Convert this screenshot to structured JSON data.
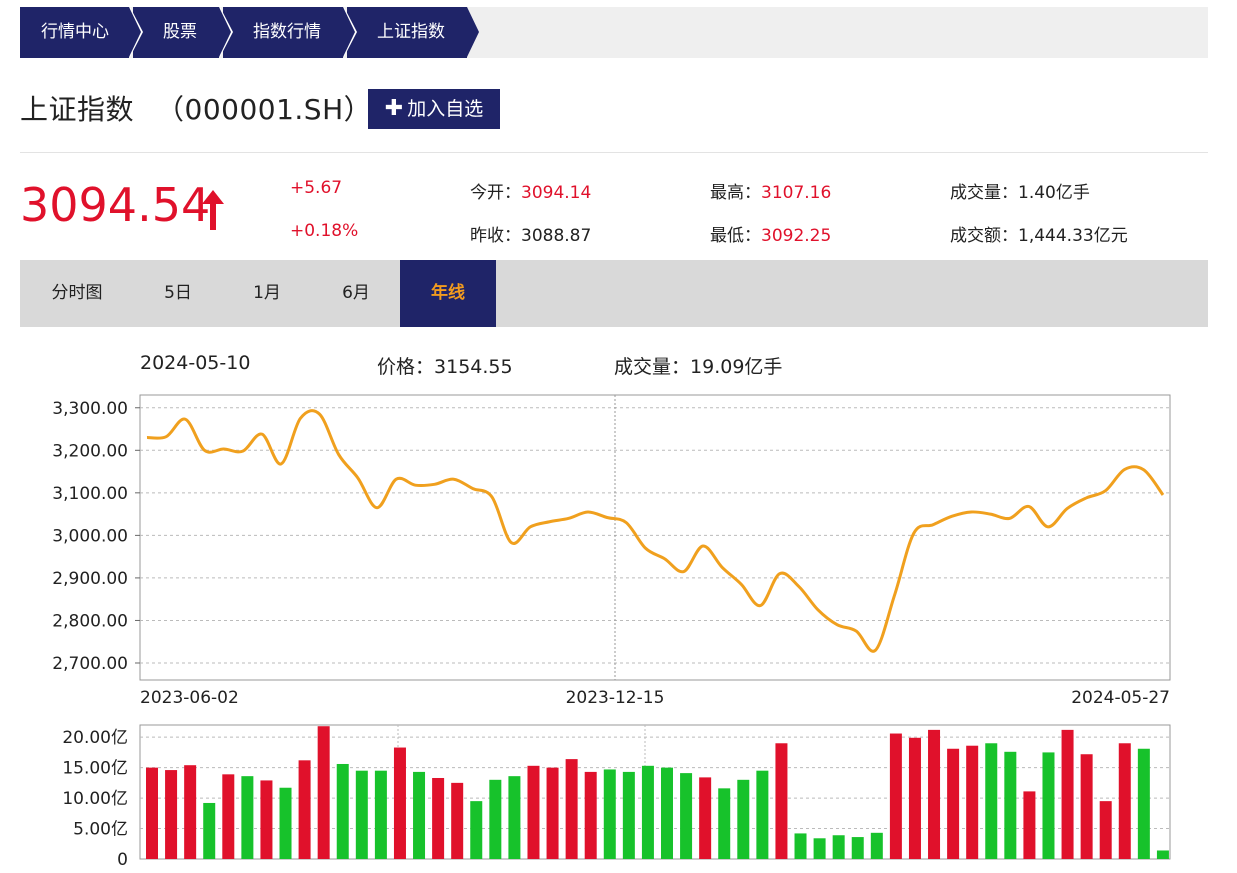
{
  "breadcrumb": [
    "行情中心",
    "股票",
    "指数行情",
    "上证指数"
  ],
  "title": {
    "name": "上证指数",
    "code": "（000001.SH）"
  },
  "add_button": {
    "icon": "plus-icon",
    "label": "加入自选"
  },
  "quote": {
    "price": "3094.54",
    "direction_icon": "arrow-up-icon",
    "change": "+5.67",
    "change_pct": "+0.18%",
    "open_label": "今开：",
    "open": "3094.14",
    "prev_close_label": "昨收：",
    "prev_close": "3088.87",
    "high_label": "最高：",
    "high": "3107.16",
    "low_label": "最低：",
    "low": "3092.25",
    "volume_label": "成交量：",
    "volume": "1.40亿手",
    "amount_label": "成交额：",
    "amount": "1,444.33亿元"
  },
  "tabs": [
    "分时图",
    "5日",
    "1月",
    "6月",
    "年线"
  ],
  "active_tab": 4,
  "hover_info": {
    "date": "2024-05-10",
    "price_label": "价格：",
    "price": "3154.55",
    "volume_label": "成交量：",
    "volume": "19.09亿手"
  },
  "colors": {
    "navy": "#1f2468",
    "red": "#e0112b",
    "green": "#17c22b",
    "line": "#f0a01e",
    "active_tab_text": "#f39c1e"
  },
  "chart_data": [
    {
      "type": "line",
      "title": "",
      "x_ticks": [
        "2023-06-02",
        "2023-12-15",
        "2024-05-27"
      ],
      "y_ticks": [
        "3,300.00",
        "3,200.00",
        "3,100.00",
        "3,000.00",
        "2,900.00",
        "2,800.00",
        "2,700.00"
      ],
      "ylim": [
        2660,
        3330
      ],
      "grid": true,
      "values": [
        3230,
        3232,
        3273,
        3200,
        3203,
        3198,
        3238,
        3168,
        3275,
        3285,
        3190,
        3135,
        3065,
        3132,
        3118,
        3120,
        3132,
        3110,
        3090,
        2983,
        3020,
        3032,
        3040,
        3055,
        3042,
        3030,
        2970,
        2945,
        2915,
        2975,
        2925,
        2885,
        2835,
        2910,
        2880,
        2825,
        2790,
        2775,
        2730,
        2860,
        3005,
        3025,
        3045,
        3055,
        3050,
        3040,
        3068,
        3020,
        3063,
        3088,
        3105,
        3155,
        3154,
        3095
      ]
    },
    {
      "type": "bar",
      "y_ticks": [
        "20.00亿",
        "15.00亿",
        "10.00亿",
        "5.00亿",
        "0"
      ],
      "ylim": [
        0,
        22
      ],
      "volume_unit": "亿",
      "values": [
        15.0,
        14.6,
        15.4,
        9.2,
        13.9,
        13.6,
        12.9,
        11.7,
        16.2,
        21.8,
        15.6,
        14.5,
        14.5,
        18.3,
        14.3,
        13.3,
        12.5,
        9.5,
        13.0,
        13.6,
        15.3,
        15.0,
        16.4,
        14.3,
        14.7,
        14.3,
        15.3,
        15.0,
        14.1,
        13.4,
        11.6,
        13.0,
        14.5,
        19.0,
        4.2,
        3.4,
        3.9,
        3.6,
        4.3,
        20.6,
        19.9,
        21.2,
        18.1,
        18.6,
        19.0,
        17.6,
        11.1,
        17.5,
        21.2,
        17.2,
        9.5,
        19.0,
        18.1,
        1.4
      ],
      "up": [
        true,
        true,
        true,
        false,
        true,
        false,
        true,
        false,
        true,
        true,
        false,
        false,
        false,
        true,
        false,
        true,
        true,
        false,
        false,
        false,
        true,
        true,
        true,
        true,
        false,
        false,
        false,
        false,
        false,
        true,
        false,
        false,
        false,
        true,
        false,
        false,
        false,
        false,
        false,
        true,
        true,
        true,
        true,
        true,
        false,
        false,
        true,
        false,
        true,
        true,
        true,
        true,
        false,
        false
      ]
    }
  ]
}
